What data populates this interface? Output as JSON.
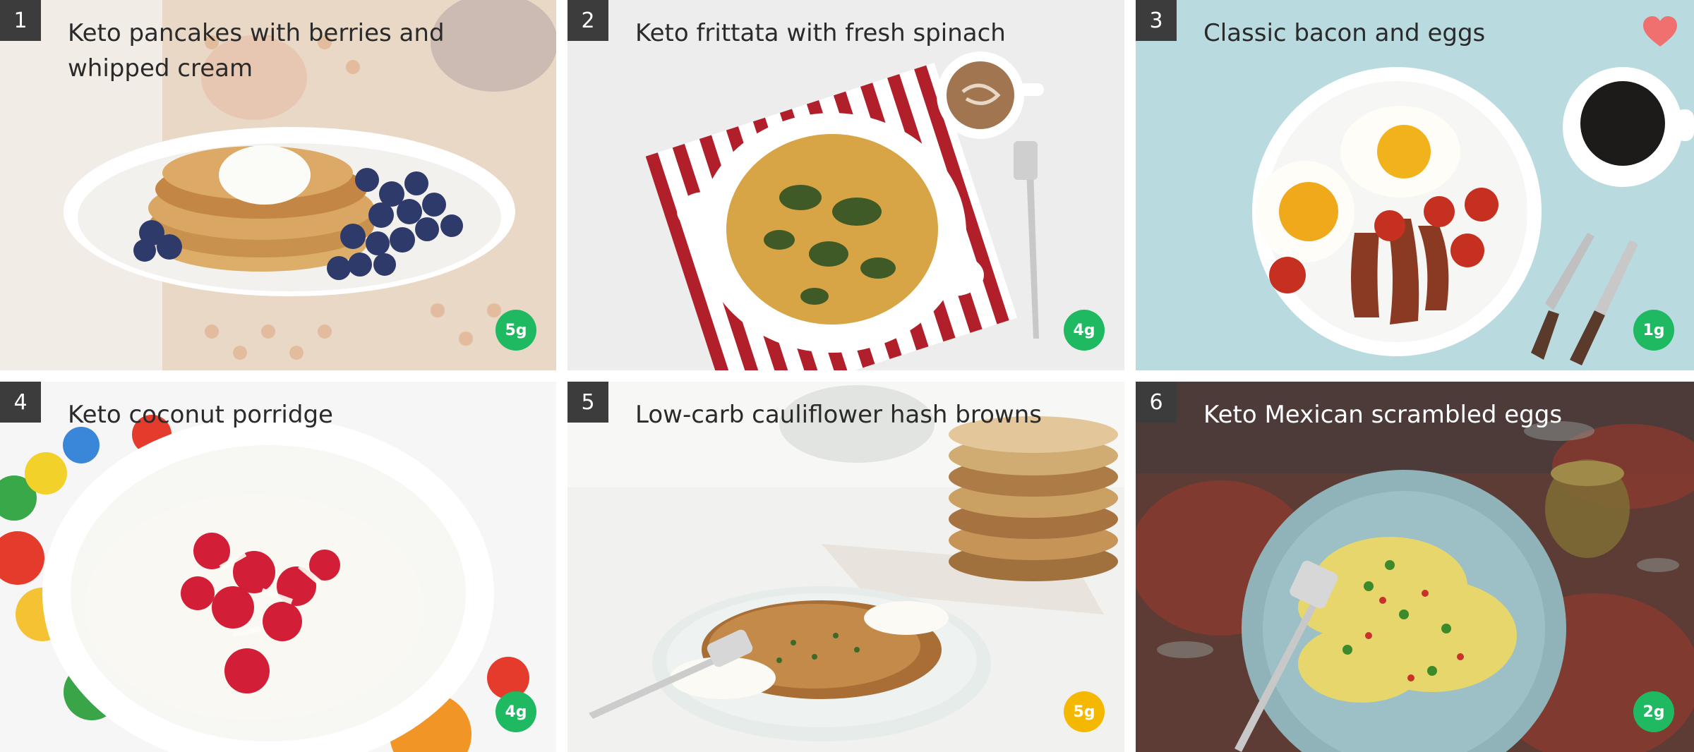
{
  "recipes": [
    {
      "number": "1",
      "title": "Keto pancakes with berries and whipped cream",
      "carbs": "5g",
      "badge_color": "#1fb962",
      "favorite": false
    },
    {
      "number": "2",
      "title": "Keto frittata with fresh spinach",
      "carbs": "4g",
      "badge_color": "#1fb962",
      "favorite": false
    },
    {
      "number": "3",
      "title": "Classic bacon and eggs",
      "carbs": "1g",
      "badge_color": "#1fb962",
      "favorite": true
    },
    {
      "number": "4",
      "title": "Keto coconut porridge",
      "carbs": "4g",
      "badge_color": "#1fb962",
      "favorite": false
    },
    {
      "number": "5",
      "title": "Low-carb cauliflower hash browns",
      "carbs": "5g",
      "badge_color": "#f5b800",
      "favorite": false
    },
    {
      "number": "6",
      "title": "Keto Mexican scrambled eggs",
      "carbs": "2g",
      "badge_color": "#1fb962",
      "favorite": false
    }
  ],
  "colors": {
    "number_tile": "#3c3c3c",
    "badge_green": "#1fb962",
    "badge_yellow": "#f5b800",
    "heart": "#f07070"
  },
  "icons": {
    "favorite": "heart-icon"
  }
}
